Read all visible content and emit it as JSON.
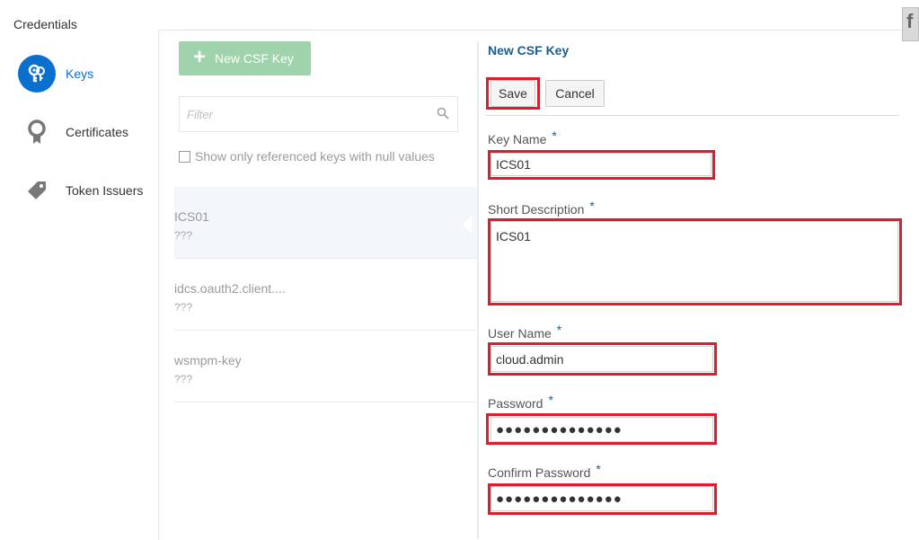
{
  "app": {
    "title": "Credentials"
  },
  "nav": {
    "items": [
      {
        "label": "Keys",
        "icon": "key-icon",
        "active": true
      },
      {
        "label": "Certificates",
        "icon": "certificate-icon",
        "active": false
      },
      {
        "label": "Token Issuers",
        "icon": "tag-icon",
        "active": false
      }
    ]
  },
  "list": {
    "new_button_label": "New CSF Key",
    "filter_placeholder": "Filter",
    "checkbox_label": "Show only referenced keys with null values",
    "items": [
      {
        "name": "ICS01",
        "desc": "???"
      },
      {
        "name": "idcs.oauth2.client....",
        "desc": "???"
      },
      {
        "name": "wsmpm-key",
        "desc": "???"
      }
    ]
  },
  "form": {
    "title": "New CSF Key",
    "save_label": "Save",
    "cancel_label": "Cancel",
    "required_mark": "*",
    "key_name_label": "Key Name",
    "key_name_value": "ICS01",
    "short_desc_label": "Short Description",
    "short_desc_value": "ICS01",
    "user_name_label": "User Name",
    "user_name_value": "cloud.admin",
    "password_label": "Password",
    "password_value": "●●●●●●●●●●●●●●",
    "confirm_password_label": "Confirm Password",
    "confirm_password_value": "●●●●●●●●●●●●●●"
  },
  "colors": {
    "accent": "#0b6fce",
    "highlight": "#e01c2c",
    "new_button": "#9fd3ab",
    "title": "#1d5c8c"
  },
  "edge_tab": {
    "glyph": "f"
  }
}
